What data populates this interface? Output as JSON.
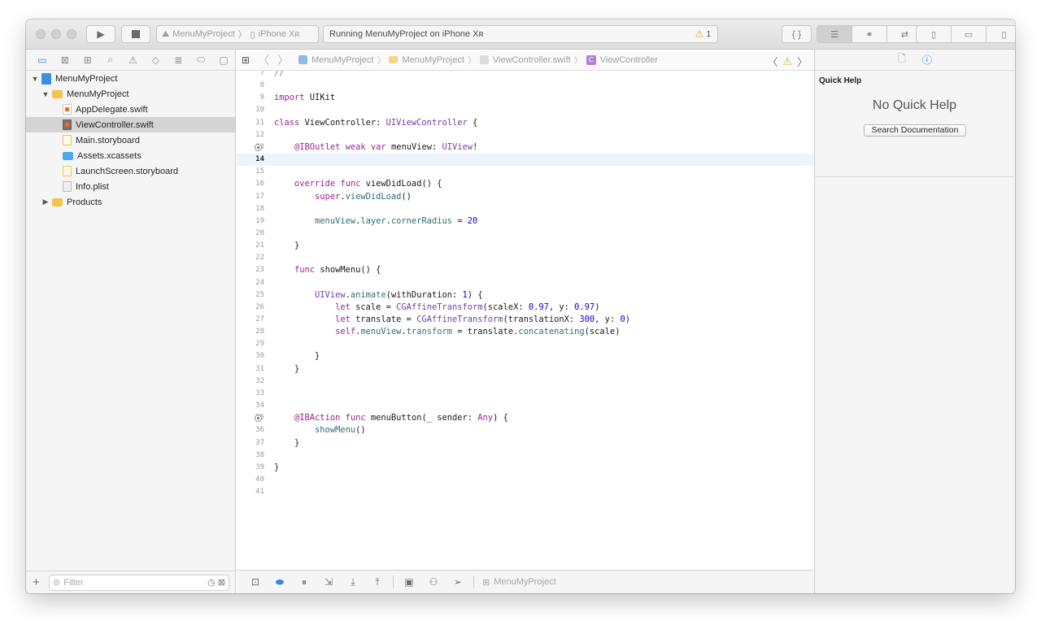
{
  "toolbar": {
    "scheme_project": "MenuMyProject",
    "scheme_device": "iPhone Xʀ",
    "status_text": "Running MenuMyProject on iPhone Xʀ",
    "warning_count": "1"
  },
  "navigator": {
    "tree": [
      {
        "label": "MenuMyProject",
        "kind": "proj",
        "indent": 0,
        "disclosure": "▼"
      },
      {
        "label": "MenuMyProject",
        "kind": "folder",
        "indent": 1,
        "disclosure": "▼"
      },
      {
        "label": "AppDelegate.swift",
        "kind": "swift",
        "indent": 2,
        "disclosure": ""
      },
      {
        "label": "ViewController.swift",
        "kind": "swift dark",
        "indent": 2,
        "disclosure": "",
        "selected": true
      },
      {
        "label": "Main.storyboard",
        "kind": "sb",
        "indent": 2,
        "disclosure": ""
      },
      {
        "label": "Assets.xcassets",
        "kind": "assets",
        "indent": 2,
        "disclosure": ""
      },
      {
        "label": "LaunchScreen.storyboard",
        "kind": "sb",
        "indent": 2,
        "disclosure": ""
      },
      {
        "label": "Info.plist",
        "kind": "plist",
        "indent": 2,
        "disclosure": ""
      },
      {
        "label": "Products",
        "kind": "folder",
        "indent": 1,
        "disclosure": "▶"
      }
    ],
    "filter_placeholder": "Filter"
  },
  "jumpbar": {
    "crumbs": [
      "MenuMyProject",
      "MenuMyProject",
      "ViewController.swift",
      "ViewController"
    ]
  },
  "editor": {
    "current_line": 14,
    "lines": [
      {
        "n": 7,
        "html": "<span class=\"cm\">//</span>"
      },
      {
        "n": 8,
        "html": ""
      },
      {
        "n": 9,
        "html": "<span class=\"kw\">import</span> UIKit"
      },
      {
        "n": 10,
        "html": ""
      },
      {
        "n": 11,
        "html": "<span class=\"kw\">class</span> ViewController: <span class=\"ty\">UIViewController</span> {"
      },
      {
        "n": 12,
        "html": ""
      },
      {
        "n": 13,
        "html": "    <span class=\"kw\">@IBOutlet</span> <span class=\"kw\">weak</span> <span class=\"kw\">var</span> menuView: <span class=\"ty\">UIView</span>!",
        "outlet": true
      },
      {
        "n": 14,
        "html": ""
      },
      {
        "n": 15,
        "html": ""
      },
      {
        "n": 16,
        "html": "    <span class=\"kw\">override</span> <span class=\"kw\">func</span> viewDidLoad() {"
      },
      {
        "n": 17,
        "html": "        <span class=\"kw\">super</span>.<span class=\"pm\">viewDidLoad</span>()"
      },
      {
        "n": 18,
        "html": ""
      },
      {
        "n": 19,
        "html": "        <span class=\"pm\">menuView</span>.<span class=\"pm\">layer</span>.<span class=\"pm\">cornerRadius</span> = <span class=\"nm\">20</span>"
      },
      {
        "n": 20,
        "html": ""
      },
      {
        "n": 21,
        "html": "    }"
      },
      {
        "n": 22,
        "html": ""
      },
      {
        "n": 23,
        "html": "    <span class=\"kw\">func</span> showMenu() {"
      },
      {
        "n": 24,
        "html": ""
      },
      {
        "n": 25,
        "html": "        <span class=\"ty\">UIView</span>.<span class=\"pm\">animate</span>(withDuration: <span class=\"nm\">1</span>) {"
      },
      {
        "n": 26,
        "html": "            <span class=\"kw\">let</span> scale = <span class=\"ty\">CGAffineTransform</span>(scaleX: <span class=\"nm\">0.97</span>, y: <span class=\"nm\">0.97</span>)"
      },
      {
        "n": 27,
        "html": "            <span class=\"kw\">let</span> translate = <span class=\"ty\">CGAffineTransform</span>(translationX: <span class=\"nm\">300</span>, y: <span class=\"nm\">0</span>)"
      },
      {
        "n": 28,
        "html": "            <span class=\"kw\">self</span>.<span class=\"pm\">menuView</span>.<span class=\"pm\">transform</span> = translate.<span class=\"pm\">concatenating</span>(scale)"
      },
      {
        "n": 29,
        "html": ""
      },
      {
        "n": 30,
        "html": "        }"
      },
      {
        "n": 31,
        "html": "    }"
      },
      {
        "n": 32,
        "html": ""
      },
      {
        "n": 33,
        "html": ""
      },
      {
        "n": 34,
        "html": ""
      },
      {
        "n": 35,
        "html": "    <span class=\"kw\">@IBAction</span> <span class=\"kw\">func</span> menuButton(_ sender: <span class=\"kw\">Any</span>) {",
        "outlet": true
      },
      {
        "n": 36,
        "html": "        <span class=\"pm\">showMenu</span>()"
      },
      {
        "n": 37,
        "html": "    }"
      },
      {
        "n": 38,
        "html": ""
      },
      {
        "n": 39,
        "html": "}"
      },
      {
        "n": 40,
        "html": ""
      },
      {
        "n": 41,
        "html": ""
      }
    ]
  },
  "debugbar": {
    "target_label": "MenuMyProject"
  },
  "inspector": {
    "title": "Quick Help",
    "empty_text": "No Quick Help",
    "search_button": "Search Documentation"
  }
}
